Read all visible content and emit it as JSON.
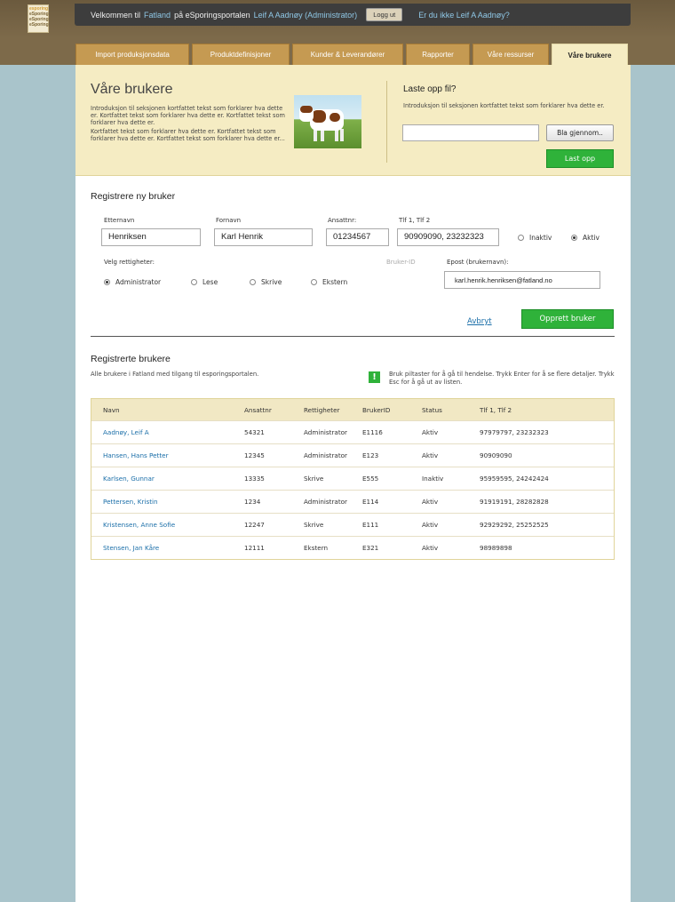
{
  "logo": {
    "lines": [
      "esporing",
      "eSporing",
      "eSporing",
      "eSporing"
    ]
  },
  "header": {
    "welcome_prefix": "Velkommen til",
    "company": "Fatland",
    "welcome_mid": "på eSporingsportalen",
    "user": "Leif A Aadnøy (Administrator)",
    "logout_label": "Logg ut",
    "not_me": "Er du ikke Leif A Aadnøy?"
  },
  "tabs": [
    {
      "label": "Import produksjonsdata",
      "active": false
    },
    {
      "label": "Produktdefinisjoner",
      "active": false
    },
    {
      "label": "Kunder & Leverandører",
      "active": false
    },
    {
      "label": "Rapporter",
      "active": false
    },
    {
      "label": "Våre ressurser",
      "active": false
    },
    {
      "label": "Våre brukere",
      "active": true
    }
  ],
  "intro": {
    "title": "Våre brukere",
    "para1": "Introduksjon til seksjonen kortfattet tekst som forklarer hva dette er. Kortfattet tekst som forklarer hva dette er. Kortfattet tekst som forklarer hva dette er.",
    "para2": "Kortfattet tekst som forklarer hva dette er. Kortfattet tekst som forklarer hva dette er. Kortfattet tekst som forklarer hva dette er..."
  },
  "upload": {
    "title": "Laste opp fil?",
    "text": "Introduksjon til seksjonen kortfattet tekst som forklarer hva dette er.",
    "file_value": "",
    "browse_label": "Bla gjennom..",
    "upload_label": "Last opp"
  },
  "register": {
    "title": "Registrere ny bruker",
    "lastname_label": "Etternavn",
    "lastname_value": "Henriksen",
    "firstname_label": "Fornavn",
    "firstname_value": "Karl Henrik",
    "empno_label": "Ansattnr:",
    "empno_value": "01234567",
    "phone_label": "Tlf 1, Tlf 2",
    "phone_value": "90909090, 23232323",
    "status_inactive": "Inaktiv",
    "status_active": "Aktiv",
    "rights_label": "Velg rettigheter:",
    "rights": [
      "Administrator",
      "Lese",
      "Skrive",
      "Ekstern"
    ],
    "userid_label": "Bruker-ID",
    "email_label": "Epost (brukernavn):",
    "email_value": "karl.henrik.henriksen@fatland.no",
    "cancel_label": "Avbryt",
    "create_label": "Opprett bruker"
  },
  "users": {
    "title": "Registrerte brukere",
    "subtitle": "Alle brukere i Fatland med tilgang til esporingsportalen.",
    "hint": "Bruk piltaster for å gå til hendelse. Trykk Enter for å se flere detaljer. Trykk Esc for å gå ut av listen.",
    "columns": [
      "Navn",
      "Ansattnr",
      "Rettigheter",
      "BrukerID",
      "Status",
      "Tlf 1, Tlf 2"
    ],
    "rows": [
      [
        "Aadnøy, Leif A",
        "54321",
        "Administrator",
        "E1116",
        "Aktiv",
        "97979797, 23232323"
      ],
      [
        "Hansen, Hans Petter",
        "12345",
        "Administrator",
        "E123",
        "Aktiv",
        "90909090"
      ],
      [
        "Karlsen, Gunnar",
        "13335",
        "Skrive",
        "E555",
        "Inaktiv",
        "95959595, 24242424"
      ],
      [
        "Pettersen, Kristin",
        "1234",
        "Administrator",
        "E114",
        "Aktiv",
        "91919191, 28282828"
      ],
      [
        "Kristensen, Anne Sofie",
        "12247",
        "Skrive",
        "E111",
        "Aktiv",
        "92929292, 25252525"
      ],
      [
        "Stensen, Jan Kåre",
        "12111",
        "Ekstern",
        "E321",
        "Aktiv",
        "98989898"
      ]
    ]
  }
}
